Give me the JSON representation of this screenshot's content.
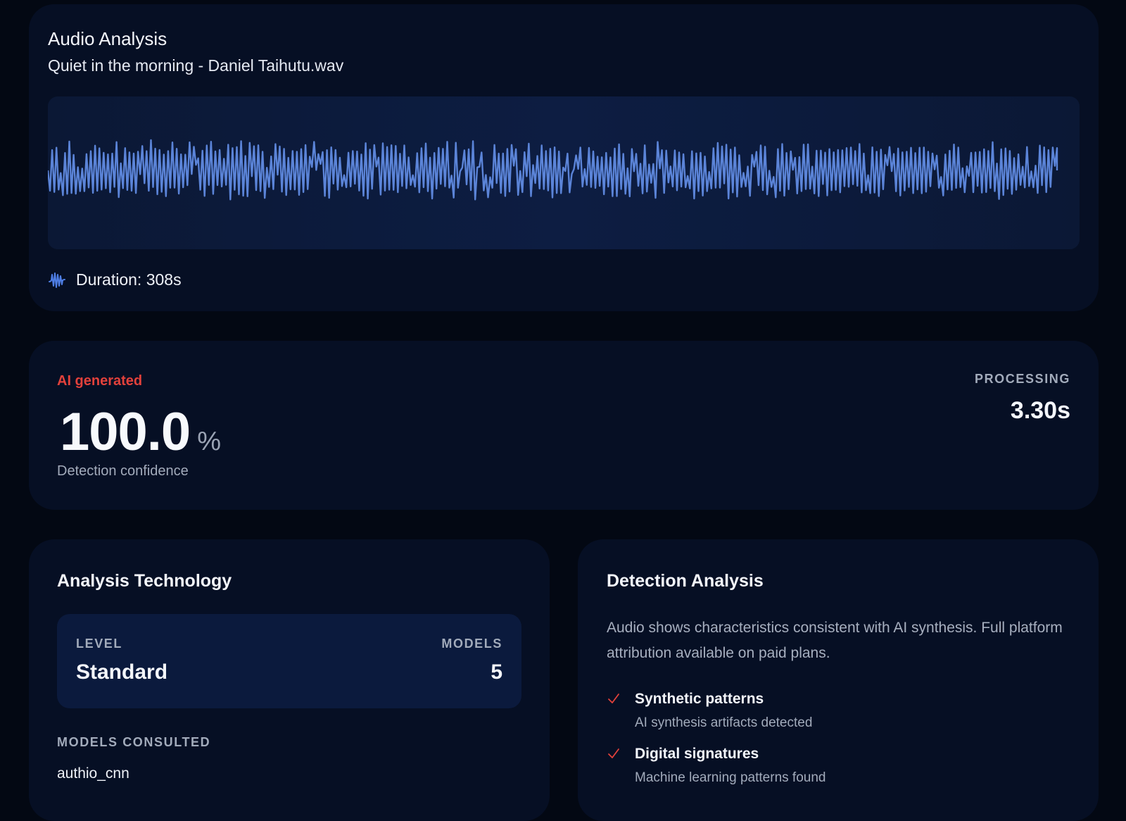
{
  "audio": {
    "title": "Audio Analysis",
    "filename": "Quiet in the morning - Daniel Taihutu.wav",
    "duration_text": "Duration: 308s",
    "duration_icon": "waveform-icon",
    "waveform_color": "#5b84d8"
  },
  "result": {
    "verdict": "AI generated",
    "verdict_color": "#e2413b",
    "confidence_value": "100.0",
    "confidence_unit": "%",
    "confidence_caption": "Detection confidence",
    "processing_label": "PROCESSING",
    "processing_value": "3.30s"
  },
  "technology": {
    "title": "Analysis Technology",
    "level_label": "LEVEL",
    "level_value": "Standard",
    "models_label": "MODELS",
    "models_value": "5",
    "consulted_label": "MODELS CONSULTED",
    "models": [
      "authio_cnn"
    ]
  },
  "detection": {
    "title": "Detection Analysis",
    "description": "Audio shows characteristics consistent with AI synthesis. Full platform attribution available on paid plans.",
    "check_color": "#e2413b",
    "findings": [
      {
        "title": "Synthetic patterns",
        "detail": "AI synthesis artifacts detected"
      },
      {
        "title": "Digital signatures",
        "detail": "Machine learning patterns found"
      }
    ]
  }
}
